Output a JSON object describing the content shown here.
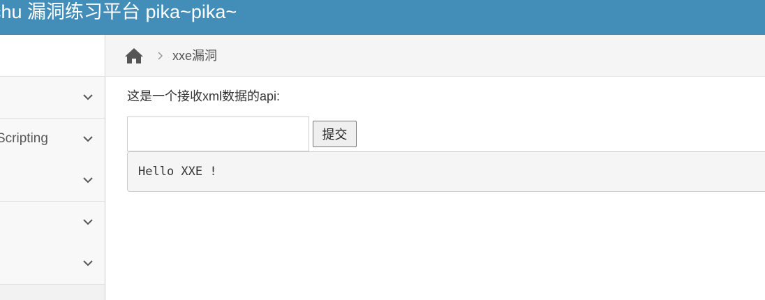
{
  "header": {
    "title": "chu 漏洞练习平台 pika~pika~"
  },
  "sidebar": {
    "items": [
      {
        "label": ""
      },
      {
        "label": "Scripting"
      },
      {
        "label": ""
      },
      {
        "label": ""
      },
      {
        "label": ""
      }
    ]
  },
  "breadcrumb": {
    "current": "xxe漏洞"
  },
  "main": {
    "prompt": "这是一个接收xml数据的api:",
    "input_value": "",
    "submit_label": "提交",
    "result": "Hello XXE !"
  },
  "colors": {
    "header_bg": "#438eb9",
    "sidebar_bg": "#f2f2f2",
    "breadcrumb_bg": "#f5f5f5"
  },
  "icons": [
    "home-icon",
    "chevron-right-icon",
    "chevron-down-icon"
  ]
}
